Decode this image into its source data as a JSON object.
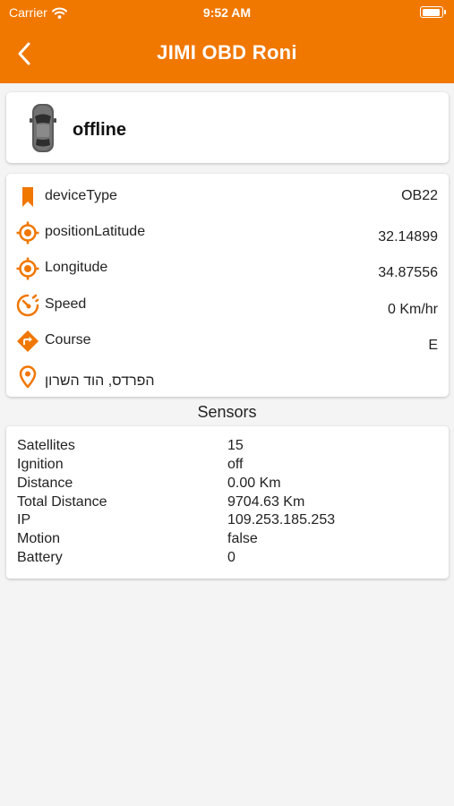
{
  "status_bar": {
    "carrier": "Carrier",
    "time": "9:52 AM"
  },
  "header": {
    "title": "JIMI OBD Roni"
  },
  "device": {
    "state": "offline"
  },
  "info": [
    {
      "icon": "bookmark-icon",
      "label": "deviceType",
      "value": "OB22"
    },
    {
      "icon": "crosshair-icon",
      "label": "positionLatitude",
      "value": "32.14899"
    },
    {
      "icon": "crosshair-icon",
      "label": "Longitude",
      "value": "34.87556"
    },
    {
      "icon": "speedometer-icon",
      "label": "Speed",
      "value": "0 Km/hr"
    },
    {
      "icon": "direction-sign-icon",
      "label": "Course",
      "value": "E"
    },
    {
      "icon": "location-pin-icon",
      "label": "הפרדס, הוד השרון",
      "value": ""
    }
  ],
  "sensors": {
    "title": "Sensors",
    "rows": [
      {
        "key": "Satellites",
        "value": "15"
      },
      {
        "key": "Ignition",
        "value": "off"
      },
      {
        "key": "Distance",
        "value": "0.00 Km"
      },
      {
        "key": "Total Distance",
        "value": "9704.63 Km"
      },
      {
        "key": "IP",
        "value": "109.253.185.253"
      },
      {
        "key": "Motion",
        "value": "false"
      },
      {
        "key": "Battery",
        "value": "0"
      }
    ]
  },
  "colors": {
    "accent": "#f07700",
    "background": "#f4f4f4"
  }
}
